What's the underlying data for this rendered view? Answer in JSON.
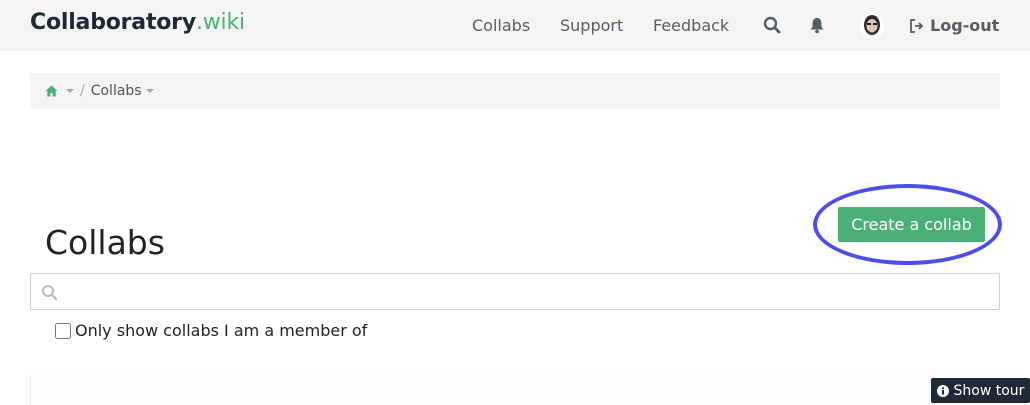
{
  "navbar": {
    "brand_main": "Collaboratory",
    "brand_suffix": ".wiki",
    "links": [
      "Collabs",
      "Support",
      "Feedback"
    ],
    "logout_label": "Log-out",
    "icons": [
      "search-icon",
      "bell-icon",
      "avatar",
      "sign-out-icon"
    ]
  },
  "breadcrumb": {
    "home_icon": "home-icon",
    "current": "Collabs"
  },
  "page": {
    "title": "Collabs",
    "create_button": "Create a collab",
    "member_filter_label": "Only show collabs I am a member of",
    "member_filter_checked": false,
    "search_value": "",
    "search_placeholder": ""
  },
  "tour": {
    "label": "Show tour"
  },
  "colors": {
    "accent": "#4caf78",
    "highlight_ring": "#3a3ae6",
    "tour_bg": "#1f2a36"
  }
}
